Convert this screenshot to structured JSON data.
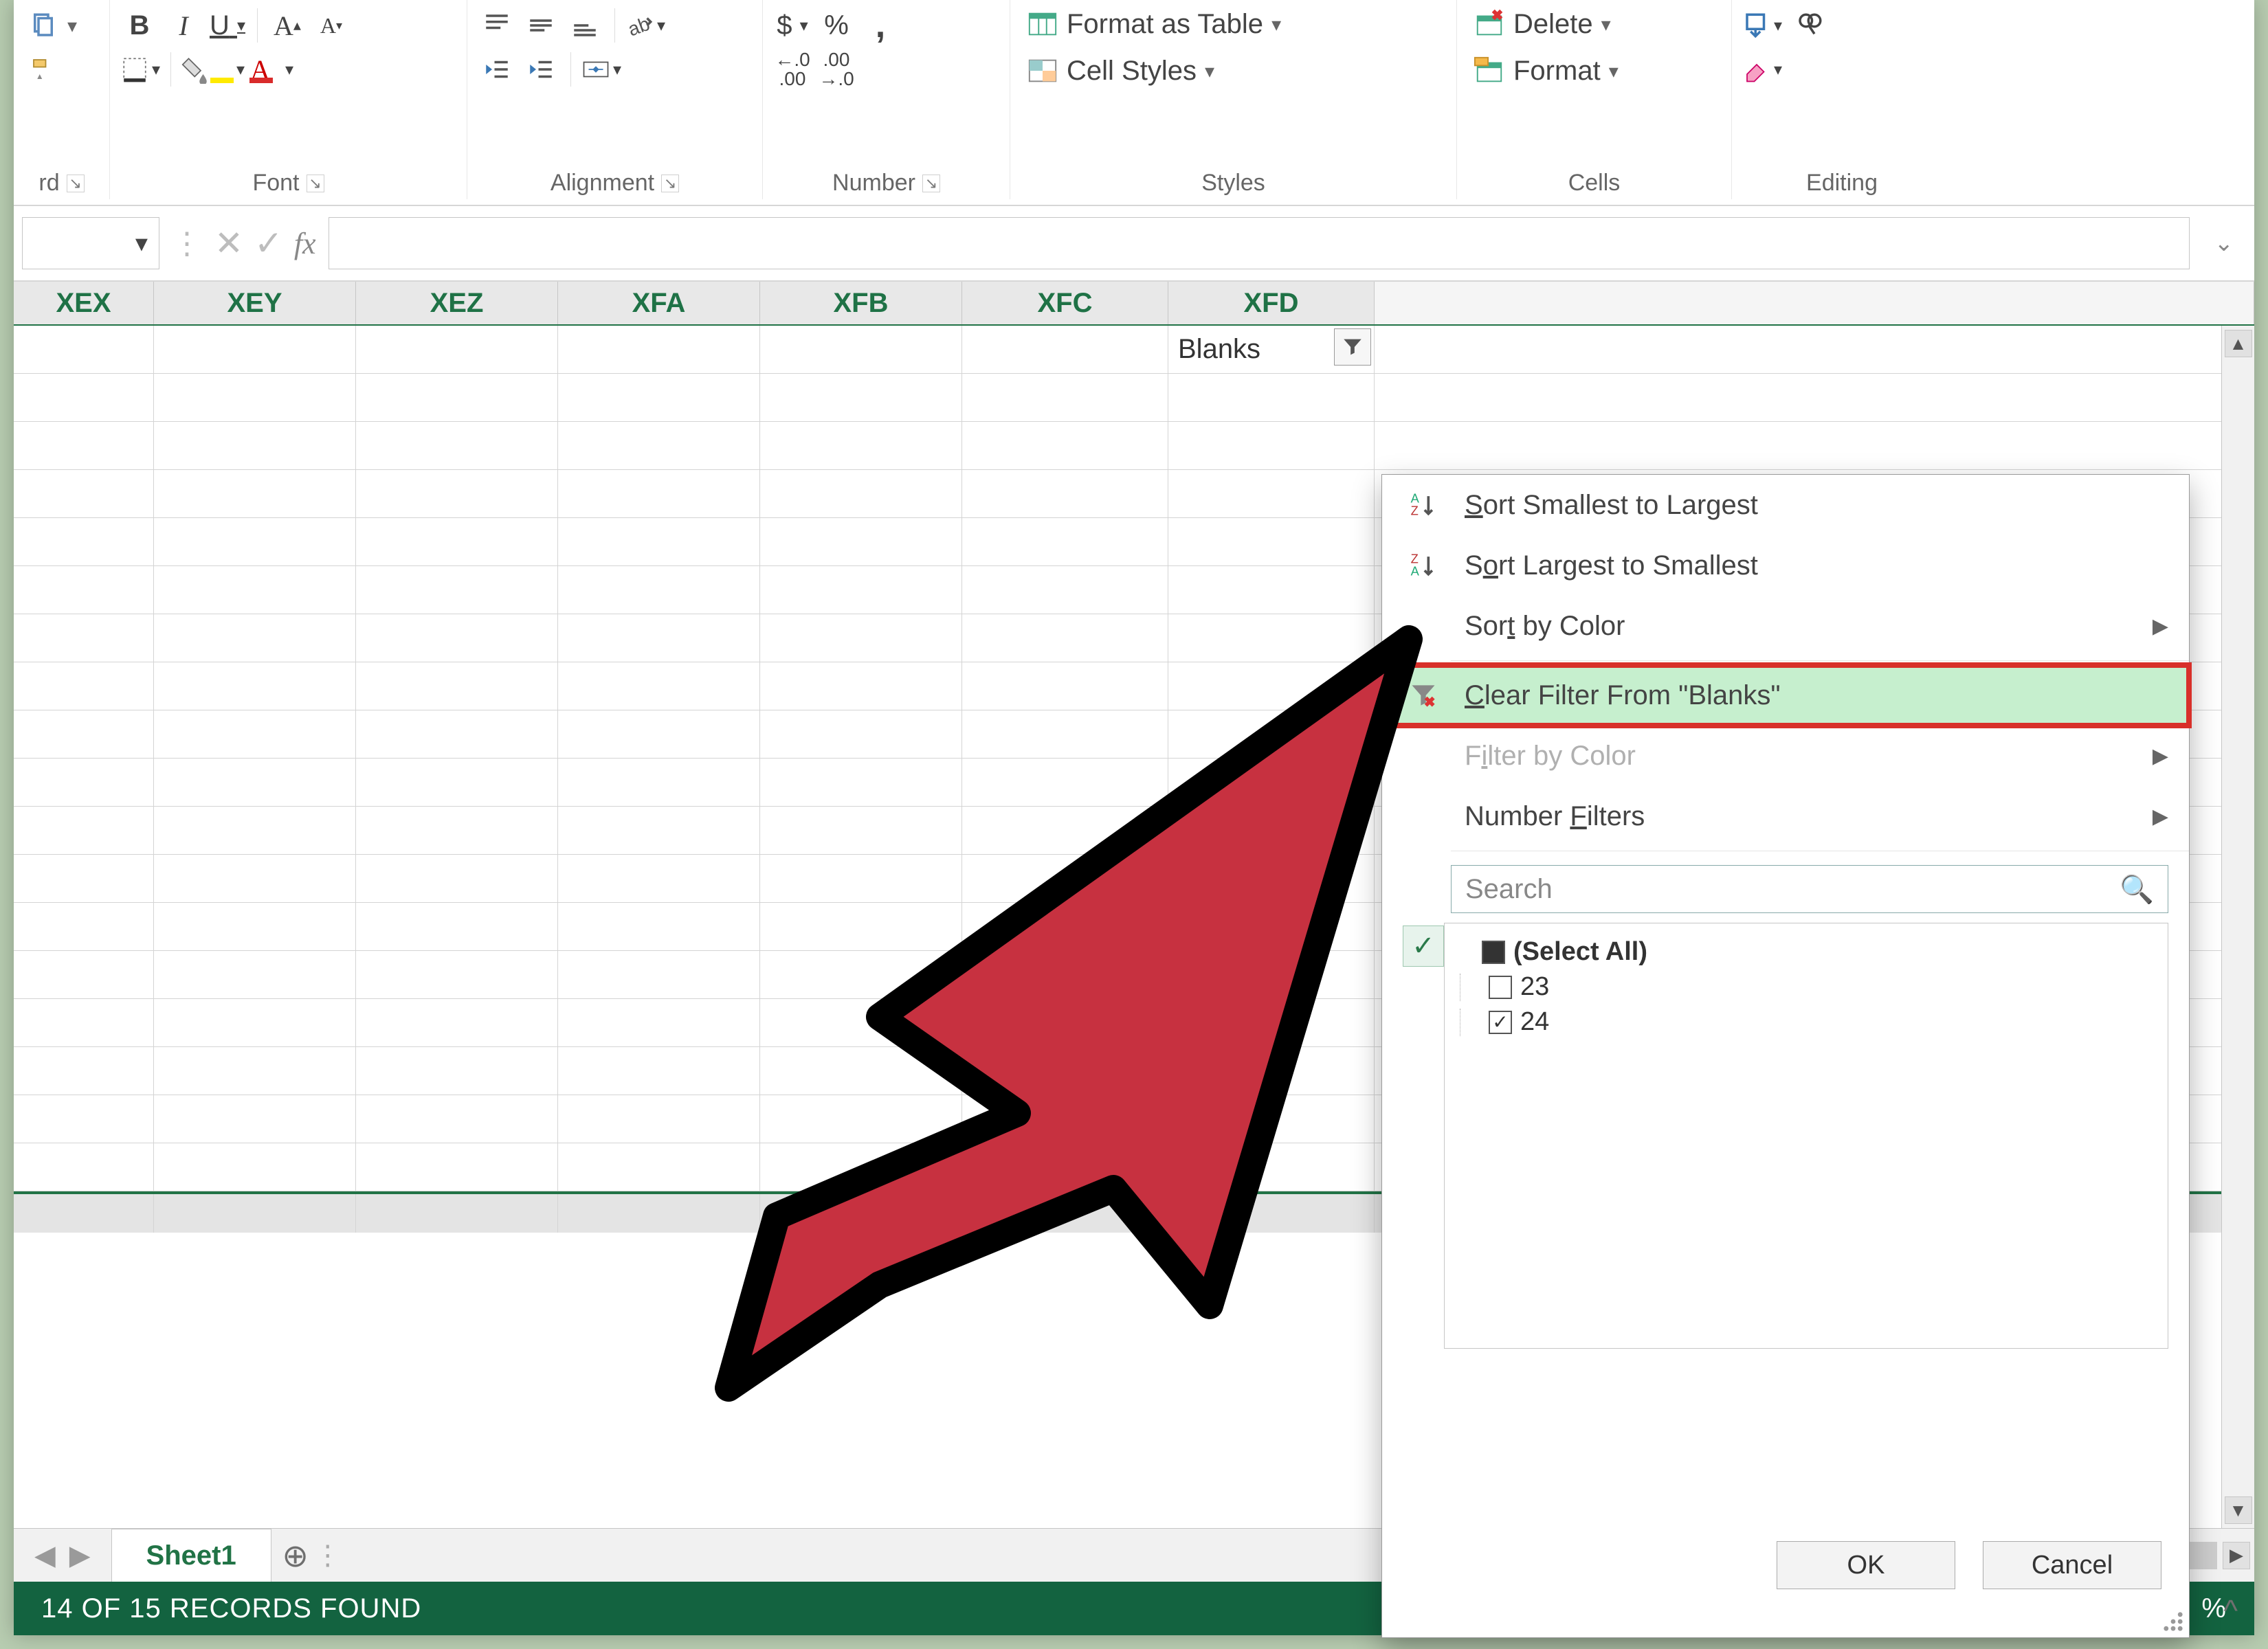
{
  "ribbon": {
    "clipboard": {
      "group_label": "rd"
    },
    "font": {
      "group_label": "Font",
      "bold": "B",
      "italic": "I",
      "underline": "U"
    },
    "alignment": {
      "group_label": "Alignment"
    },
    "number": {
      "group_label": "Number",
      "currency": "$",
      "percent": "%",
      "comma": ",",
      "inc_dec": ".00",
      "dec_inc": ".0"
    },
    "styles": {
      "group_label": "Styles",
      "format_as_table": "Format as Table",
      "cell_styles": "Cell Styles"
    },
    "cells": {
      "group_label": "Cells",
      "delete": "Delete",
      "format": "Format"
    },
    "editing": {
      "group_label": "Editing"
    }
  },
  "formula_bar": {
    "fx": "fx"
  },
  "columns": [
    "XEX",
    "XEY",
    "XEZ",
    "XFA",
    "XFB",
    "XFC",
    "XFD"
  ],
  "first_cell_value": "Blanks",
  "sheet_tabs": {
    "active": "Sheet1"
  },
  "status_bar": {
    "left": "14 OF 15 RECORDS FOUND",
    "right": "%"
  },
  "filter_menu": {
    "sort_asc": "Sort Smallest to Largest",
    "sort_desc": "Sort Largest to Smallest",
    "sort_by_color": "Sort by Color",
    "clear_filter": "Clear Filter From \"Blanks\"",
    "filter_by_color": "Filter by Color",
    "number_filters": "Number Filters",
    "search_placeholder": "Search",
    "select_all": "(Select All)",
    "items": [
      {
        "label": "23",
        "checked": false
      },
      {
        "label": "24",
        "checked": true
      }
    ],
    "ok": "OK",
    "cancel": "Cancel"
  }
}
